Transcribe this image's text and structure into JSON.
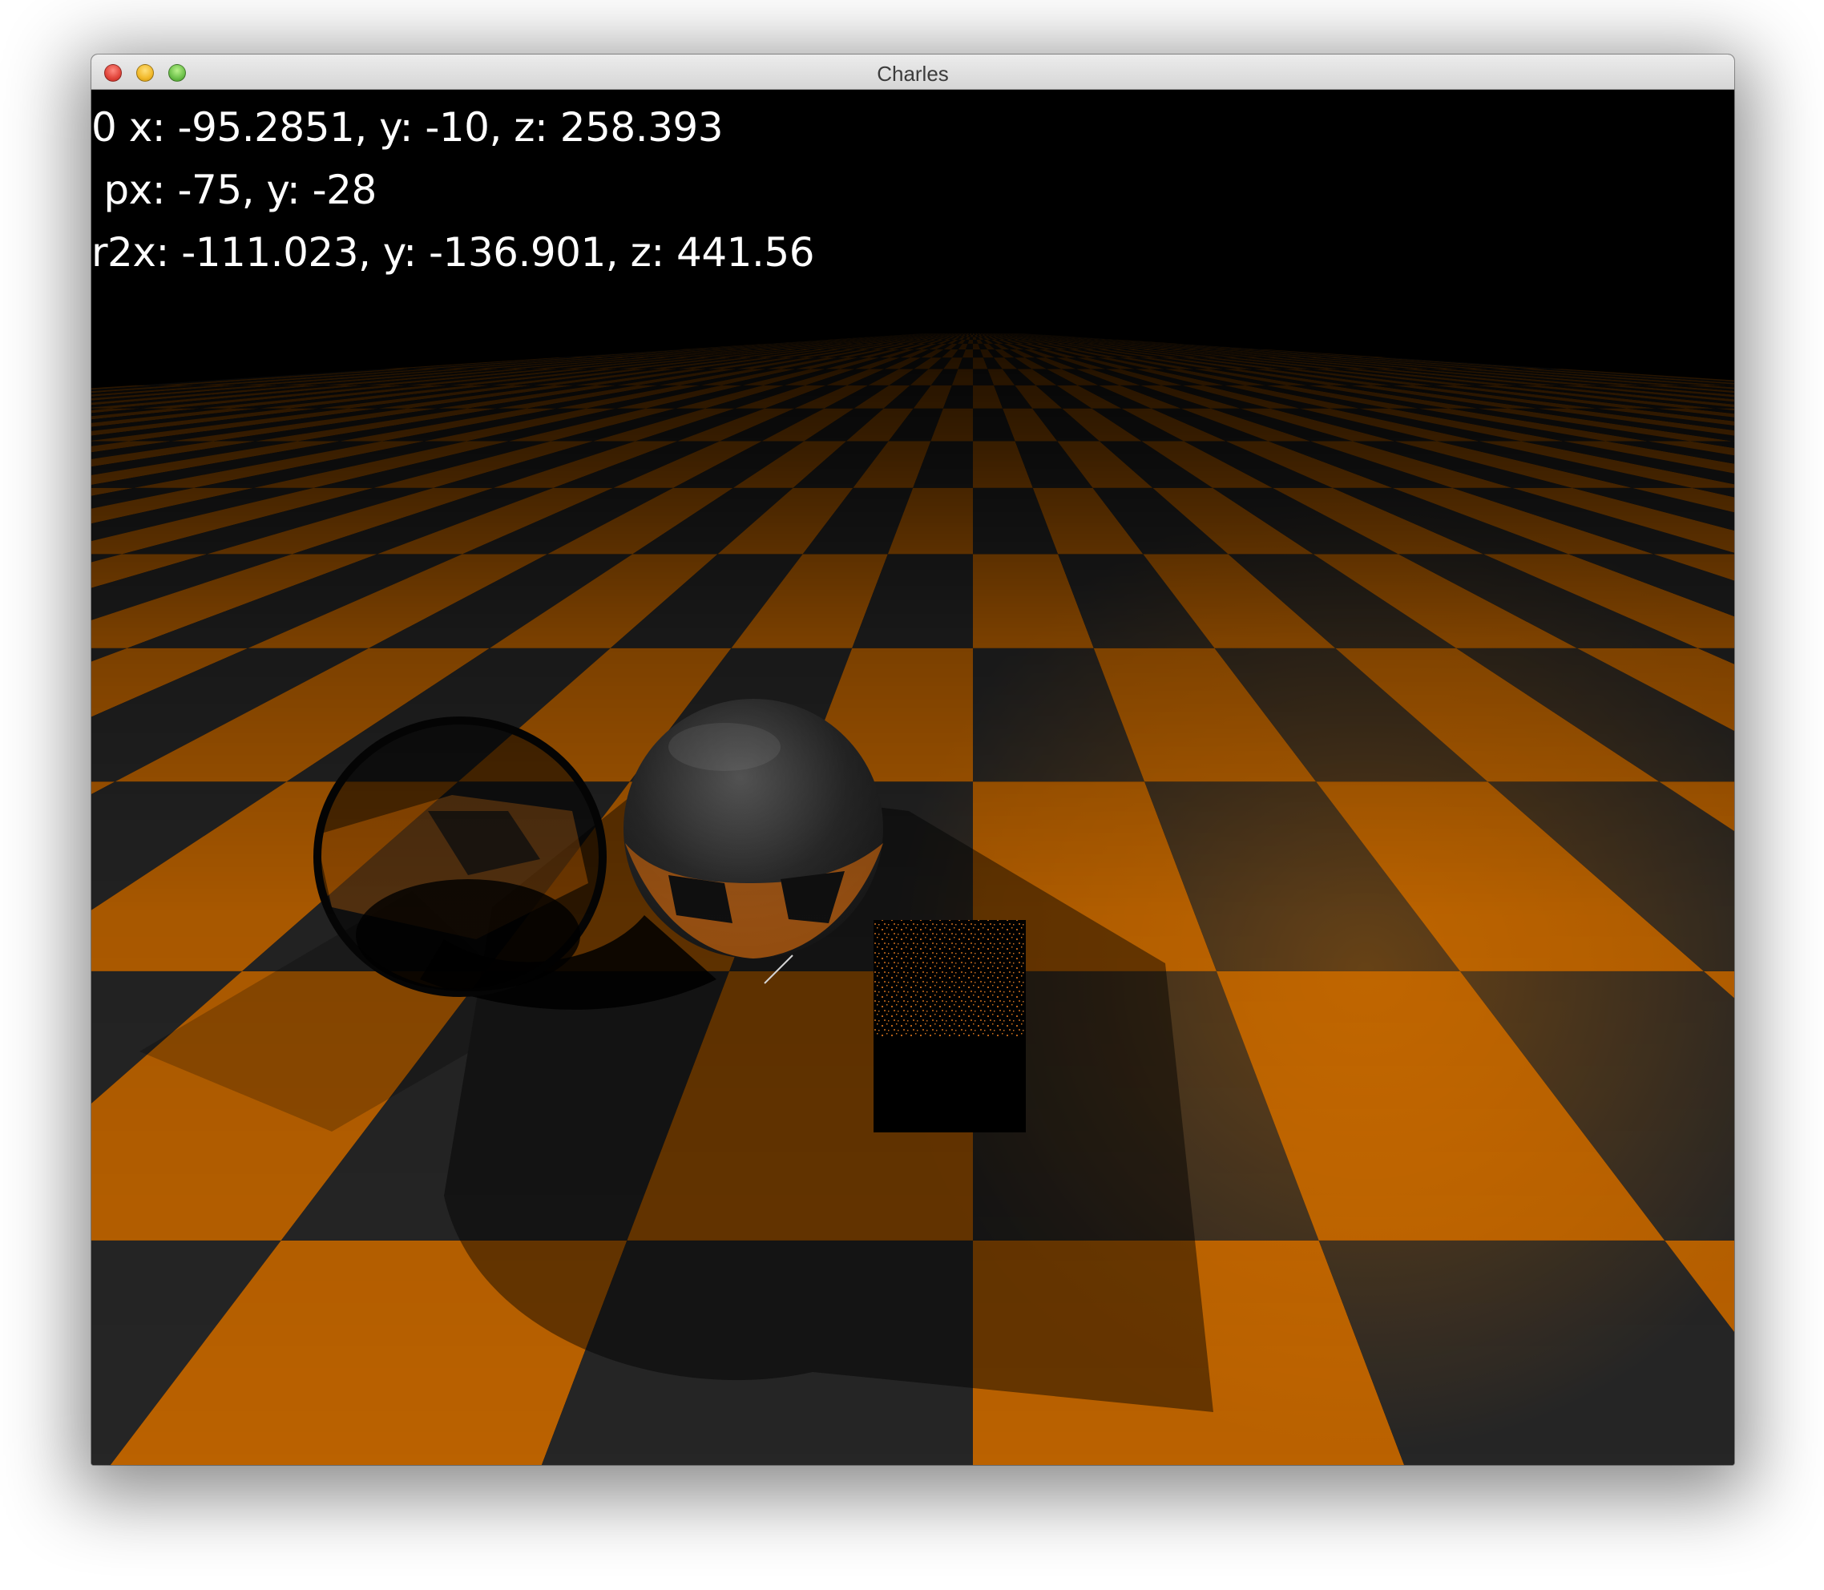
{
  "window": {
    "title": "Charles"
  },
  "hud": {
    "line1": "0 x: -95.2851, y: -10, z: 258.393",
    "line2": " px: -75, y: -28",
    "line3": "r2x: -111.023, y: -136.901, z: 441.56"
  },
  "scene": {
    "floor_orange": "#f07d00",
    "floor_dark": "#262626",
    "background": "#000000"
  }
}
